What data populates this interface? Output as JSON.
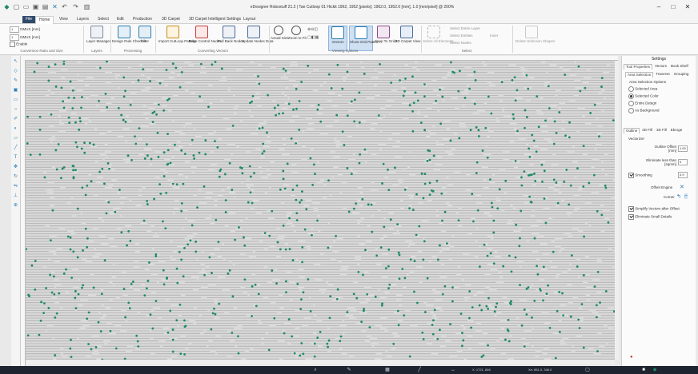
{
  "window": {
    "title": "eDesigner Roboxtuff 21.2 | Tan Cutloop 01 Hickit 1962, 1952 [pixels]: 1962.0, 1952.0 [mm], 1.0 [mm/pixel] @ 200%",
    "controls": [
      "–",
      "□",
      "✕"
    ]
  },
  "tabs": [
    "File",
    "Home",
    "View",
    "Layers",
    "Select",
    "Edit",
    "Production",
    "3D Carpet",
    "3D Carpet Intelligent Settings",
    "Layout"
  ],
  "active_tab": "Home",
  "ribbon": {
    "convert": {
      "row1_value": "1",
      "row1_unit_a": "DMUX",
      "row1_unit_b": "[mm]",
      "row2_value": "1",
      "row2_unit_a": "DMUX",
      "row2_unit_b": "[mm]",
      "enable_label": "Enable",
      "group_label": "Conversion Ratio and Size"
    },
    "layers_btn": "Layer Manager",
    "layers_group": "Layers",
    "processing_btns": [
      "Design Rule Checker",
      "Filter"
    ],
    "processing_group": "Processing",
    "cutloop_btns": [
      "Import CutLoop Pattern",
      "Edge Control Nodes"
    ],
    "converting_btns": [
      "Pull Back Nodes",
      "Update Nodes Data"
    ],
    "converting_group": "Converting Vectors",
    "viewing_btns": [
      "Actual Size",
      "Zoom to Fit",
      "Vectors",
      "Show Grid Pattern",
      "Snap To Grids",
      "3D Carpet View"
    ],
    "viewing_group": "Viewing Options",
    "select_btn": "Select All Elements",
    "select_options": [
      "Select Entire Layer",
      "Select Entities",
      "Select Nodes"
    ],
    "select_extra": "Inner",
    "select_group": "Select",
    "delete_btn": "Delete Selection Shapes"
  },
  "right_panel": {
    "header": "Settings",
    "tabs": [
      "Tool Properties",
      "Vectors",
      "Book Shelf"
    ],
    "subtabs": [
      "Area Selection",
      "Traverse",
      "Grouping"
    ],
    "section": "Area Selection Options",
    "options": [
      "Selected Area",
      "Selected Color",
      "Entire Design",
      "As Background"
    ],
    "selected_option": "Selected Color",
    "outline_tabs": [
      "Outline",
      "2D Fill",
      "3D Fill",
      "Ebroge"
    ],
    "vectorizer": "Vectorizer",
    "outline_offset_label": "Outline Offset [mm]",
    "outline_offset_value": "1.00",
    "eliminate_label": "Eliminate less than [sqmm]",
    "eliminate_value": "0",
    "smoothing_label": "Smoothing",
    "smoothing_value": "0.9",
    "offset_engine_label": "Offset Engine",
    "corner_label": "Corner",
    "simplify_label": "Simplify Vectors after Offset",
    "eliminate_small_label": "Eliminate Small Details"
  },
  "taskbar": {
    "coords_a": "X: 1721, 846",
    "coords_b": "Xe: 851.0, 346.0"
  },
  "colors": {
    "accent": "#2f4a6b",
    "dot": "#1e8a68",
    "canvas_bg": "#d9d9d9",
    "line": "#9c9c9c",
    "highlight": "#2a7db3"
  }
}
